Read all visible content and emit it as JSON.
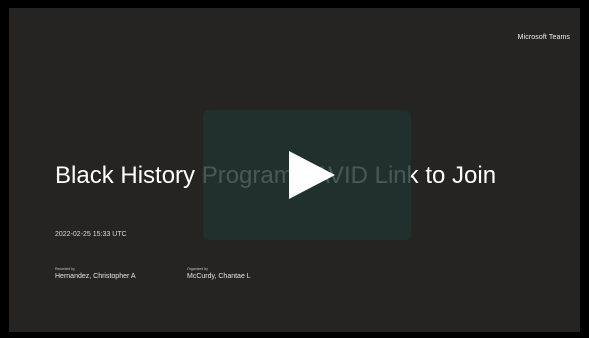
{
  "brand": "Microsoft Teams",
  "meeting": {
    "title": "Black History Program - AVID Link to Join",
    "timestamp": "2022-02-25 15:33 UTC"
  },
  "participants": [
    {
      "role": "Recorded by",
      "name": "Hernandez, Christopher A"
    },
    {
      "role": "Organized by",
      "name": "McCurdy, Chantae L"
    }
  ],
  "play_button": {
    "icon": "play-icon"
  },
  "colors": {
    "background": "#252423",
    "overlay": "#1f3330",
    "text": "#ffffff"
  }
}
